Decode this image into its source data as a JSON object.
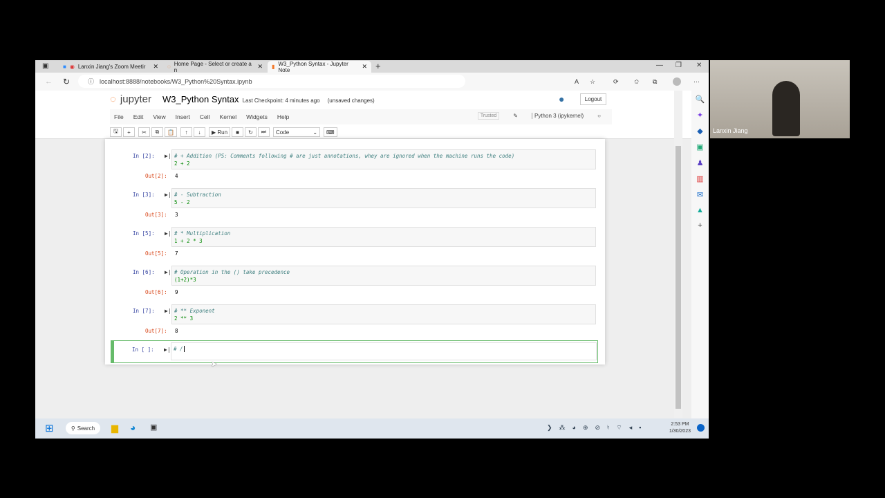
{
  "browser": {
    "tabs": [
      {
        "label": "Lanxin Jiang's Zoom Meetir"
      },
      {
        "label": "Home Page - Select or create a n"
      },
      {
        "label": "W3_Python Syntax - Jupyter Note"
      }
    ],
    "new_tab": "+",
    "url": "localhost:8888/notebooks/W3_Python%20Syntax.ipynb"
  },
  "jupyter": {
    "logo": "jupyter",
    "title": "W3_Python Syntax",
    "checkpoint": "Last Checkpoint: 4 minutes ago",
    "unsaved": "(unsaved changes)",
    "logout": "Logout",
    "menu": [
      "File",
      "Edit",
      "View",
      "Insert",
      "Cell",
      "Kernel",
      "Widgets",
      "Help"
    ],
    "trusted": "Trusted",
    "kernel": "Python 3 (ipykernel)",
    "run": "Run",
    "cell_type": "Code"
  },
  "cells": [
    {
      "prompt": "In [2]:",
      "comment": "# + Addition (PS: Comments following # are just annotations, whey are ignored when the machine runs the code)",
      "code": "2 + 2",
      "out_prompt": "Out[2]:",
      "out": "4"
    },
    {
      "prompt": "In [3]:",
      "comment": "# - Subtraction",
      "code": "5 - 2",
      "out_prompt": "Out[3]:",
      "out": "3"
    },
    {
      "prompt": "In [5]:",
      "comment": "# * Multiplication",
      "code": "1 + 2 * 3",
      "out_prompt": "Out[5]:",
      "out": "7"
    },
    {
      "prompt": "In [6]:",
      "comment": "# Operation in the () take precedence",
      "code": "(1+2)*3",
      "out_prompt": "Out[6]:",
      "out": "9"
    },
    {
      "prompt": "In [7]:",
      "comment": "# ** Exponent",
      "code": "2 ** 3",
      "out_prompt": "Out[7]:",
      "out": "8"
    }
  ],
  "active_cell": {
    "prompt": "In [ ]:",
    "code": "# /"
  },
  "taskbar": {
    "search": "Search",
    "time": "2:53 PM",
    "date": "1/30/2023"
  },
  "webcam": {
    "name": "Lanxin Jiang"
  }
}
